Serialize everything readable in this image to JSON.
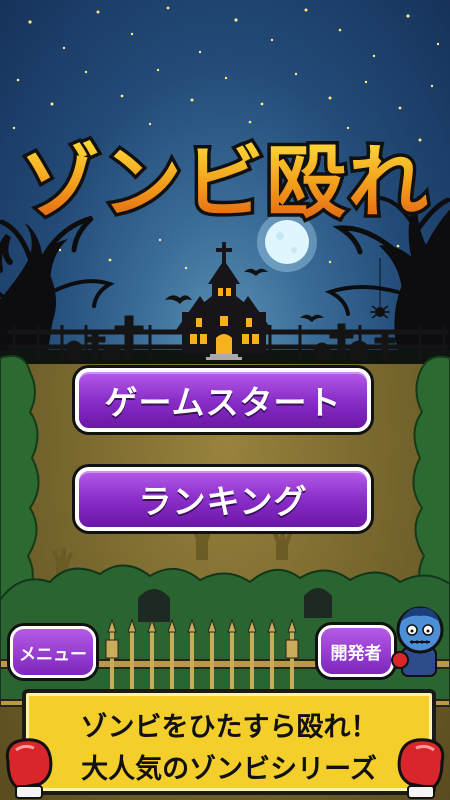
{
  "game": {
    "title": "ゾンビ殴れ"
  },
  "menu": {
    "start_label": "ゲームスタート",
    "ranking_label": "ランキング"
  },
  "footer": {
    "menu_label": "メニュー",
    "developer_label": "開発者",
    "banner_line1": "ゾンビをひたすら殴れ！",
    "banner_line2": "大人気のゾンビシリーズ"
  },
  "colors": {
    "button_purple": "#8a2ec9",
    "banner_yellow": "#f4cf2c",
    "title_orange": "#f29a1a",
    "moon": "#dff6ff"
  },
  "icons": [
    "moon-icon",
    "haunted-house-icon",
    "graveyard-icon",
    "spider-icon",
    "bat-icon",
    "zombie-mascot-icon",
    "boxing-glove-icon"
  ]
}
